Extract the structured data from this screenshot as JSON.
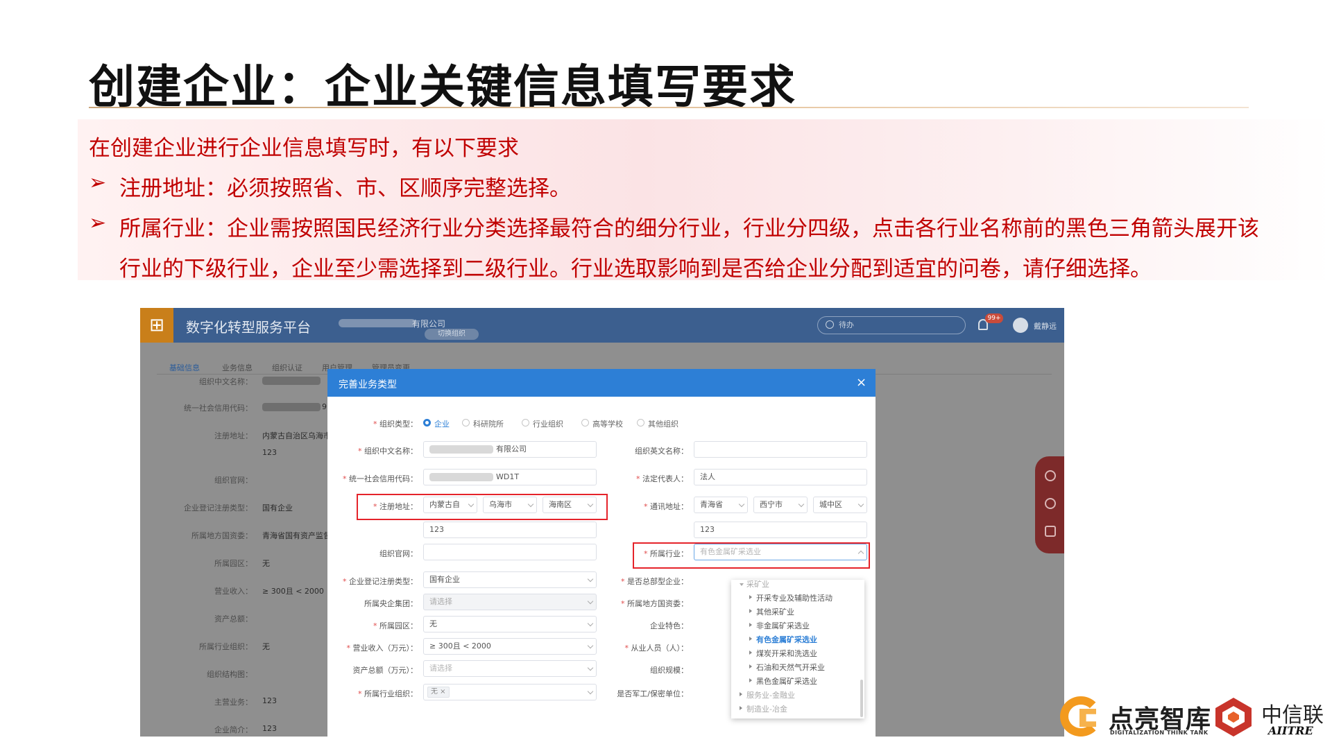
{
  "slide": {
    "title": "创建企业：企业关键信息填写要求",
    "intro": "在创建企业进行企业信息填写时，有以下要求",
    "bullet_marker": "➢",
    "bullet1": "注册地址：必须按照省、市、区顺序完整选择。",
    "bullet2_line1": "所属行业：企业需按照国民经济行业分类选择最符合的细分行业，行业分四级，点击各行业名称前的黑色三角箭头展开该",
    "bullet2_line2": "行业的下级行业，企业至少需选择到二级行业。行业选取影响到是否给企业分配到适宜的问卷，请仔细选择。"
  },
  "app": {
    "title": "数字化转型服务平台",
    "org_suffix": "有限公司",
    "org_tag": "切换组织",
    "search_placeholder": "待办",
    "badge": "99+",
    "user": "戴静远",
    "tabs": [
      "基础信息",
      "业务信息",
      "组织认证",
      "用户管理",
      "管理员变更"
    ]
  },
  "background_form": [
    {
      "label": "组织中文名称：",
      "value": ""
    },
    {
      "label": "统一社会信用代码：",
      "value": "9"
    },
    {
      "label": "注册地址：",
      "value": "内蒙古自治区乌海市"
    },
    {
      "label": "",
      "value": "123"
    },
    {
      "label": "组织官网：",
      "value": ""
    },
    {
      "label": "企业登记注册类型：",
      "value": "国有企业"
    },
    {
      "label": "所属地方国资委：",
      "value": "青海省国有资产监督"
    },
    {
      "label": "所属园区：",
      "value": "无"
    },
    {
      "label": "营业收入：",
      "value": "≥ 300且 < 2000"
    },
    {
      "label": "资产总额：",
      "value": ""
    },
    {
      "label": "所属行业组织：",
      "value": "无"
    },
    {
      "label": "组织结构图：",
      "value": ""
    },
    {
      "label": "主营业务：",
      "value": "123"
    },
    {
      "label": "企业简介：",
      "value": "123"
    }
  ],
  "modal": {
    "title": "完善业务类型",
    "close": "×",
    "org_type_label": "组织类型：",
    "org_types": [
      "企业",
      "科研院所",
      "行业组织",
      "高等学校",
      "其他组织"
    ],
    "cn_name_label": "组织中文名称：",
    "cn_name_suffix": "有限公司",
    "en_name_label": "组织英文名称：",
    "credit_label": "统一社会信用代码：",
    "credit_suffix": "WD1T",
    "legal_label": "法定代表人：",
    "legal_value": "法人",
    "reg_addr_label": "注册地址：",
    "reg_province": "内蒙古自",
    "reg_city": "乌海市",
    "reg_district": "海南区",
    "reg_detail": "123",
    "mail_addr_label": "通讯地址：",
    "mail_province": "青海省",
    "mail_city": "西宁市",
    "mail_district": "城中区",
    "mail_detail": "123",
    "website_label": "组织官网：",
    "industry_label": "所属行业：",
    "industry_value": "有色金属矿采选业",
    "reg_type_label": "企业登记注册类型：",
    "reg_type_value": "国有企业",
    "hq_label": "是否总部型企业：",
    "central_group_label": "所属央企集团：",
    "central_group_value": "请选择",
    "local_sasac_label": "所属地方国资委：",
    "park_label": "所属园区：",
    "park_value": "无",
    "feature_label": "企业特色：",
    "revenue_label": "营业收入（万元）：",
    "revenue_value": "≥ 300且 < 2000",
    "staff_label": "从业人员（人）：",
    "assets_label": "资产总额（万元）：",
    "assets_value": "请选择",
    "scale_label": "组织规模：",
    "ind_org_label": "所属行业组织：",
    "ind_org_tag": "无 ×",
    "military_label": "是否军工/保密单位："
  },
  "dropdown": {
    "parent": "采矿业",
    "children": [
      "开采专业及辅助性活动",
      "其他采矿业",
      "非金属矿采选业",
      "有色金属矿采选业",
      "煤炭开采和洗选业",
      "石油和天然气开采业",
      "黑色金属矿采选业"
    ],
    "siblings": [
      "服务业-金融业",
      "制造业-冶金"
    ]
  },
  "logos": {
    "dl_name": "点亮智库",
    "dl_sub": "DIGITALIZATION THINK TANK",
    "zx_name": "中信联",
    "zx_sub": "AIITRE"
  },
  "colors": {
    "accent_red": "#c00000",
    "highlight_red": "#e5232a",
    "modal_blue": "#2d7fd6",
    "header_blue": "#3c5f8f"
  }
}
